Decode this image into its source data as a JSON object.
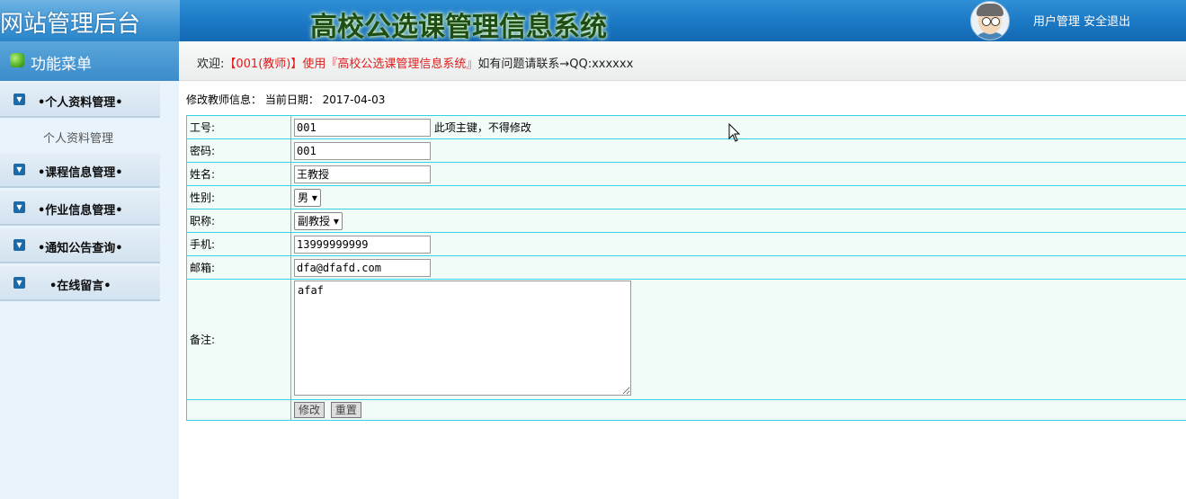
{
  "header": {
    "logo": "网站管理后台",
    "system_title": "高校公选课管理信息系统",
    "links": [
      "用户管理",
      "安全退出"
    ]
  },
  "sidebar": {
    "title": "功能菜单",
    "groups": [
      {
        "label": "•个人资料管理•",
        "expanded": true,
        "items": [
          "个人资料管理"
        ]
      },
      {
        "label": "•课程信息管理•"
      },
      {
        "label": "•作业信息管理•"
      },
      {
        "label": "•通知公告查询•"
      },
      {
        "label": "•在线留言•"
      }
    ]
  },
  "welcome": {
    "prefix": "欢迎:",
    "user": "【001(教师)】使用『高校公选课管理信息系统』",
    "suffix": "如有问题请联系→QQ:xxxxxx"
  },
  "form": {
    "info": "修改教师信息： 当前日期： 2017-04-03",
    "fields": {
      "id": {
        "label": "工号:",
        "value": "001",
        "hint": "此项主键，不得修改"
      },
      "password": {
        "label": "密码:",
        "value": "001"
      },
      "name": {
        "label": "姓名:",
        "value": "王教授"
      },
      "gender": {
        "label": "性别:",
        "value": "男"
      },
      "title": {
        "label": "职称:",
        "value": "副教授"
      },
      "phone": {
        "label": "手机:",
        "value": "13999999999"
      },
      "email": {
        "label": "邮箱:",
        "value": "dfa@dfafd.com"
      },
      "note": {
        "label": "备注:",
        "value": "afaf"
      }
    },
    "buttons": {
      "submit": "修改",
      "reset": "重置"
    }
  }
}
